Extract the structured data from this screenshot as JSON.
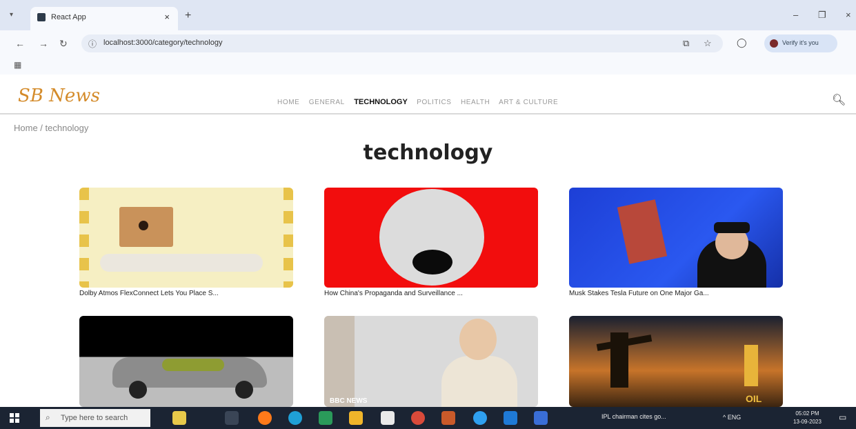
{
  "browser": {
    "tab_title": "React App",
    "tab_close": "×",
    "new_tab": "+",
    "tab_list": "▾",
    "window_controls": [
      "–",
      "❐",
      "×"
    ],
    "url": "localhost:3000/category/technology",
    "verify_label": "Verify it's you",
    "nav_icons": [
      "←",
      "→",
      "↻"
    ],
    "info_icon": "ⓘ",
    "toolbar_icons": [
      "⧉",
      "☆",
      "◯"
    ],
    "apps_icon": "▦"
  },
  "site": {
    "logo": "SB News",
    "menu": [
      "HOME",
      "GENERAL",
      "TECHNOLOGY",
      "POLITICS",
      "HEALTH",
      "ART & CULTURE"
    ],
    "active": "TECHNOLOGY",
    "search_icon": "search-icon",
    "search_glyph": "🔍︎",
    "breadcrumb": "Home / technology",
    "page_title": "technology"
  },
  "articles": [
    {
      "caption": "Dolby Atmos FlexConnect Lets You Place S..."
    },
    {
      "caption": "How China's Propaganda and Surveillance ..."
    },
    {
      "caption": "Musk Stakes Tesla Future on One Major Ga..."
    },
    {
      "caption": ""
    },
    {
      "caption": "",
      "overlay": "BBC NEWS"
    },
    {
      "caption": "",
      "overlay": "OIL"
    }
  ],
  "taskbar": {
    "search_icon": "⌕",
    "search_placeholder": "Type here to search",
    "news": "IPL chairman cites go...",
    "tray": "^  ENG",
    "time": "05:02 PM",
    "date": "13-09-2023",
    "notif": "▭"
  }
}
